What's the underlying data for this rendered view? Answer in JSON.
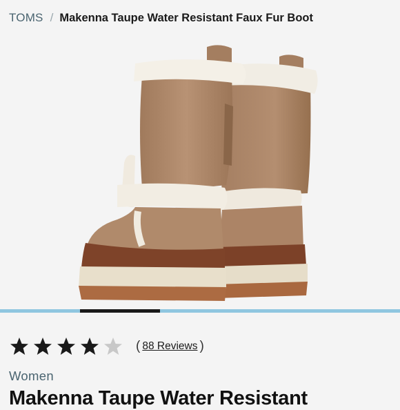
{
  "breadcrumb": {
    "brand": "TOMS",
    "separator": "/",
    "current": "Makenna Taupe Water Resistant Faux Fur Boot"
  },
  "gallery": {
    "image_name": "boot-product-image",
    "slide_progress": {
      "current": 2,
      "total": 5
    }
  },
  "rating": {
    "stars": 4,
    "max_stars": 5,
    "reviews_label": "88 Reviews",
    "open_paren": "(",
    "close_paren": ")"
  },
  "product": {
    "category": "Women",
    "title": "Makenna Taupe Water Resistant"
  },
  "colors": {
    "accent": "#8fc6e0",
    "star_filled": "#1a1a1a",
    "star_empty": "#c8c8c8",
    "muted_text": "#4a6470"
  }
}
